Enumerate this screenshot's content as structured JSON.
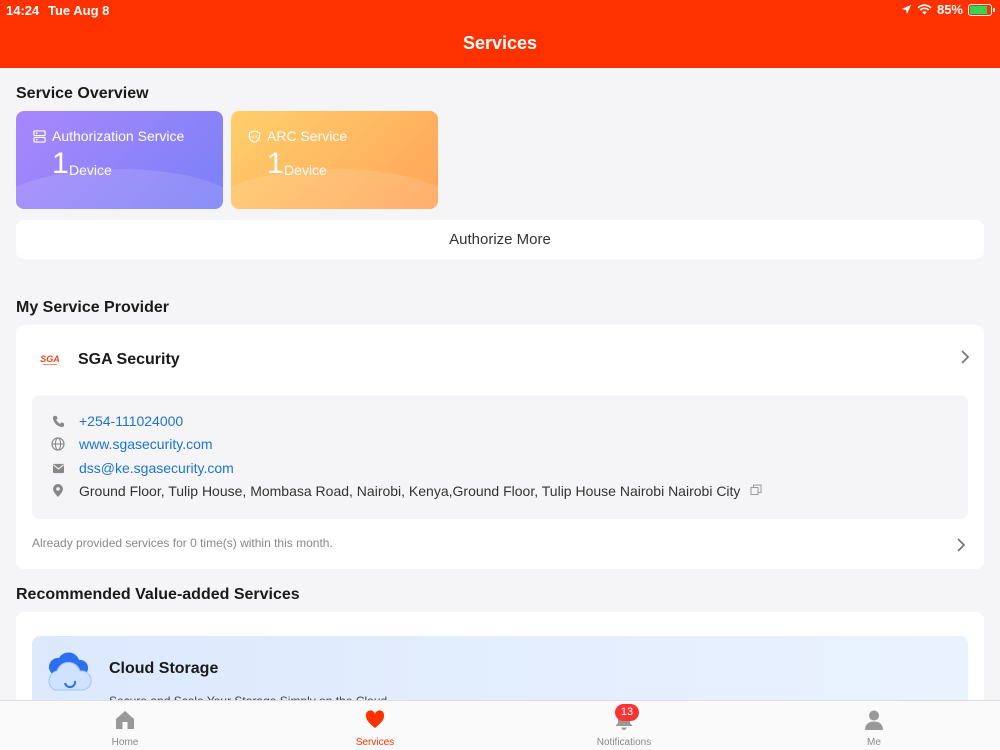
{
  "status_bar": {
    "time": "14:24",
    "date": "Tue Aug 8",
    "battery": "85%"
  },
  "header": {
    "title": "Services"
  },
  "overview": {
    "title": "Service Overview",
    "cards": [
      {
        "name": "Authorization Service",
        "count": "1",
        "unit": "Device"
      },
      {
        "name": "ARC Service",
        "count": "1",
        "unit": "Device"
      }
    ],
    "authorize_more": "Authorize More"
  },
  "provider": {
    "section_title": "My Service Provider",
    "logo_text": "SGA",
    "name": "SGA Security",
    "phone": "+254-111024000",
    "website": "www.sgasecurity.com",
    "email": "dss@ke.sgasecurity.com",
    "address": "Ground Floor, Tulip House, Mombasa Road, Nairobi, Kenya,Ground Floor, Tulip House Nairobi Nairobi City",
    "provided_text": "Already provided services for 0 time(s) within this month."
  },
  "recommended": {
    "section_title": "Recommended Value-added Services",
    "item_title": "Cloud Storage",
    "item_desc": "Secure and Scale Your Storage Simply on the Cloud"
  },
  "tabbar": {
    "home": "Home",
    "services": "Services",
    "notifications": "Notifications",
    "notifications_badge": "13",
    "me": "Me"
  },
  "colors": {
    "brand": "#fd3200",
    "link": "#1b74d4",
    "badge": "#ff3333"
  }
}
